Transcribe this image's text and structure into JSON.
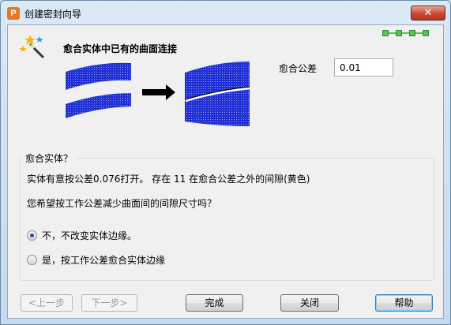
{
  "window": {
    "title": "创建密封向导",
    "close_symbol": "✕",
    "app_icon_letter": "P"
  },
  "header": {
    "heading": "愈合实体中已有的曲面连接",
    "wizard_progress": {
      "total_steps": 4,
      "icon": "progress-steps-icon"
    },
    "wizard_icon": "magic-wand-icon"
  },
  "tolerance": {
    "label": "愈合公差",
    "value": "0.01"
  },
  "group": {
    "title": "愈合实体？",
    "message": "实体有意按公差0.076打开。 存在 11 在愈合公差之外的间隙(黄色)",
    "question": "您希望按工作公差减少曲面间的间隙尺寸吗？",
    "options": [
      {
        "label": "不，不改变实体边缘。",
        "checked": true
      },
      {
        "label": "是，按工作公差愈合实体边缘",
        "checked": false
      }
    ]
  },
  "buttons": {
    "back": "<上一步",
    "next": "下一步>",
    "finish": "完成",
    "close": "关闭",
    "help": "帮助"
  },
  "colors": {
    "surface_blue": "#1f2fd0",
    "progress_green": "#59c35a",
    "selected_radio": "#1f4ea8"
  }
}
